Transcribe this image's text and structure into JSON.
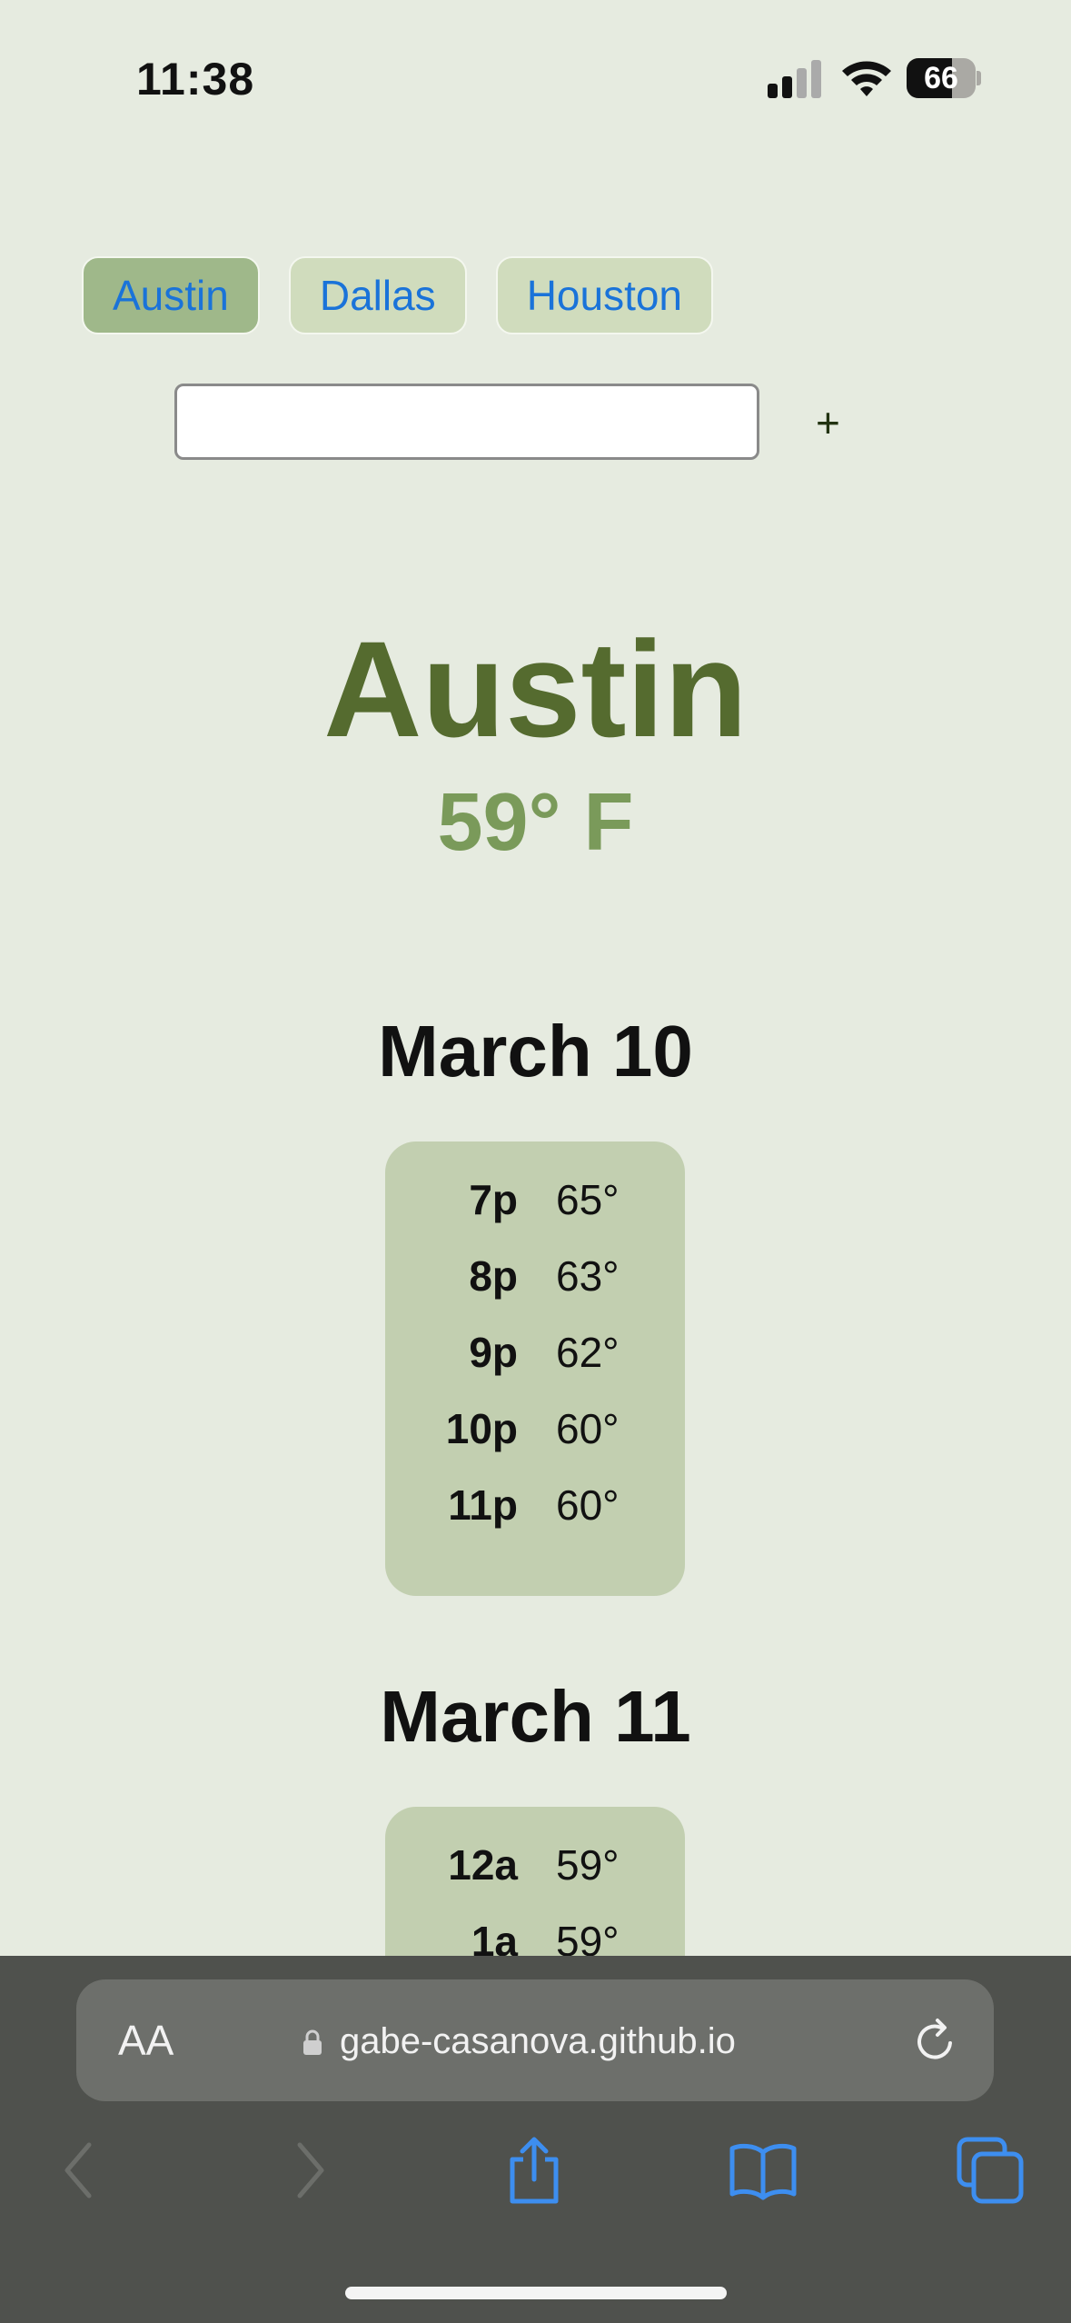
{
  "status_bar": {
    "time": "11:38",
    "battery": "66",
    "battery_level": 0.66
  },
  "tabs": [
    {
      "label": "Austin",
      "active": true
    },
    {
      "label": "Dallas",
      "active": false
    },
    {
      "label": "Houston",
      "active": false
    }
  ],
  "search": {
    "value": "",
    "placeholder": "",
    "add_label": "+"
  },
  "current": {
    "city": "Austin",
    "temperature": "59° F"
  },
  "days": [
    {
      "date": "March 10",
      "hours": [
        {
          "time": "7p",
          "temp": "65°"
        },
        {
          "time": "8p",
          "temp": "63°"
        },
        {
          "time": "9p",
          "temp": "62°"
        },
        {
          "time": "10p",
          "temp": "60°"
        },
        {
          "time": "11p",
          "temp": "60°"
        }
      ]
    },
    {
      "date": "March 11",
      "hours": [
        {
          "time": "12a",
          "temp": "59°"
        },
        {
          "time": "1a",
          "temp": "59°"
        }
      ]
    }
  ],
  "browser": {
    "text_size_label": "AA",
    "url": "gabe-casanova.github.io",
    "icons": [
      "lock-icon",
      "reload-icon",
      "back-icon",
      "forward-icon",
      "share-icon",
      "bookmarks-icon",
      "tabs-icon"
    ]
  },
  "colors": {
    "background": "#e6ebe0",
    "accent_link": "#1a73d9",
    "city_heading": "#556b2f",
    "temp_text": "#7a9a5a",
    "card": "#c2cfb0",
    "tab_active": "#9fb88a",
    "tab_inactive": "#d0dcbd"
  }
}
